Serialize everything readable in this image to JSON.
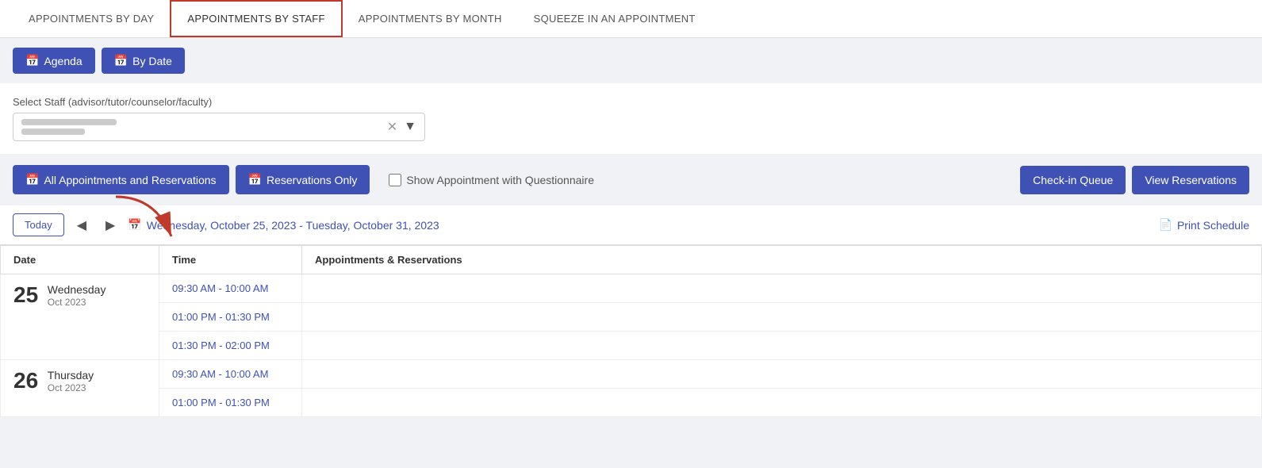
{
  "tabs": [
    {
      "id": "by-day",
      "label": "APPOINTMENTS BY DAY",
      "active": false
    },
    {
      "id": "by-staff",
      "label": "APPOINTMENTS BY STAFF",
      "active": true
    },
    {
      "id": "by-month",
      "label": "APPOINTMENTS BY MONTH",
      "active": false
    },
    {
      "id": "squeeze-in",
      "label": "SQUEEZE IN AN APPOINTMENT",
      "active": false
    }
  ],
  "view_buttons": [
    {
      "id": "agenda",
      "label": "Agenda",
      "icon": "📅"
    },
    {
      "id": "by-date",
      "label": "By Date",
      "icon": "📅"
    }
  ],
  "select_staff": {
    "label": "Select Staff (advisor/tutor/counselor/faculty)",
    "placeholder": ""
  },
  "filter_buttons": [
    {
      "id": "all-appts",
      "label": "All Appointments and Reservations",
      "icon": "📅",
      "active": true
    },
    {
      "id": "reservations-only",
      "label": "Reservations Only",
      "icon": "📅",
      "active": true
    }
  ],
  "show_questionnaire_label": "Show Appointment with Questionnaire",
  "action_buttons": [
    {
      "id": "check-in-queue",
      "label": "Check-in Queue"
    },
    {
      "id": "view-reservations",
      "label": "View Reservations"
    }
  ],
  "date_nav": {
    "today_label": "Today",
    "date_range": "Wednesday, October 25, 2023 - Tuesday, October 31, 2023",
    "print_label": "Print Schedule"
  },
  "table_headers": [
    {
      "id": "date",
      "label": "Date"
    },
    {
      "id": "time",
      "label": "Time"
    },
    {
      "id": "appts",
      "label": "Appointments & Reservations"
    }
  ],
  "table_rows": [
    {
      "date_number": "25",
      "date_day": "Wednesday",
      "date_month_year": "Oct 2023",
      "times": [
        "09:30 AM - 10:00 AM",
        "01:00 PM - 01:30 PM",
        "01:30 PM - 02:00 PM"
      ]
    },
    {
      "date_number": "26",
      "date_day": "Thursday",
      "date_month_year": "Oct 2023",
      "times": [
        "09:30 AM - 10:00 AM",
        "01:00 PM - 01:30 PM"
      ]
    }
  ]
}
